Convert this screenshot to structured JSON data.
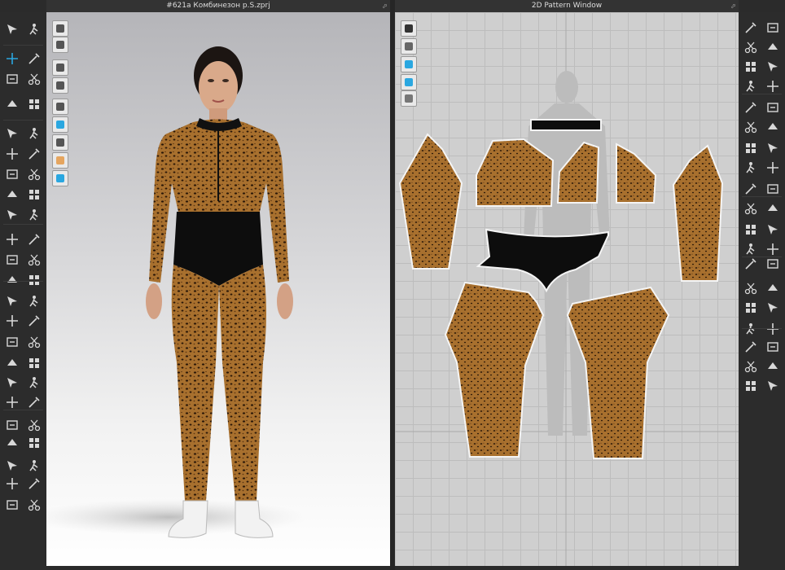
{
  "window_3d": {
    "title": "#621a Комбинезон  p.S.zprj",
    "maximize_glyph": "⬀"
  },
  "window_2d": {
    "title": "2D Pattern Window",
    "maximize_glyph": "⬀"
  },
  "colors": {
    "toolbar_bg": "#2c2c2c",
    "accent_blue": "#2aa7e0",
    "leopard": "#a8702e",
    "black_fabric": "#0d0d0d",
    "pattern_bg": "#cfcfcf"
  },
  "toolbar_left": {
    "icons": [
      "select-move-icon",
      "walk-pose-icon",
      "transform-icon",
      "pin-icon",
      "tack-icon",
      "scissors-icon",
      "fold-icon",
      "arrange-icon",
      "steam-icon",
      "measure-icon",
      "shape-icon",
      "avatar-icon",
      "needle-icon",
      "button-icon",
      "zipper-icon",
      "piping-icon",
      "print-icon",
      "hanger-icon",
      "camera-icon",
      "lock-icon",
      "ruler-icon",
      "brush-icon",
      "swap-icon",
      "tape-icon"
    ]
  },
  "toolbar_right": {
    "icons": [
      "polygon-icon",
      "rectangle-icon",
      "curve-icon",
      "edit-point-icon",
      "sewing-icon",
      "segment-sewing-icon",
      "internal-line-icon",
      "dart-icon",
      "notch-icon",
      "pleat-icon",
      "trim-icon",
      "fold-arrangement-icon",
      "text-icon",
      "label-icon",
      "grading-icon",
      "symmetry-icon"
    ]
  },
  "viewport_3d_tools": [
    "display-avatar-icon",
    "display-garment-icon",
    "show-avatar-icon",
    "show-garment-icon",
    "show-pins-icon",
    "texture-icon",
    "surface-icon",
    "skin-icon",
    "environment-icon"
  ],
  "viewport_2d_tools": [
    "show-baseline-icon",
    "show-garment-2d-icon",
    "info-icon",
    "fabric-icon",
    "lock-2d-icon"
  ]
}
